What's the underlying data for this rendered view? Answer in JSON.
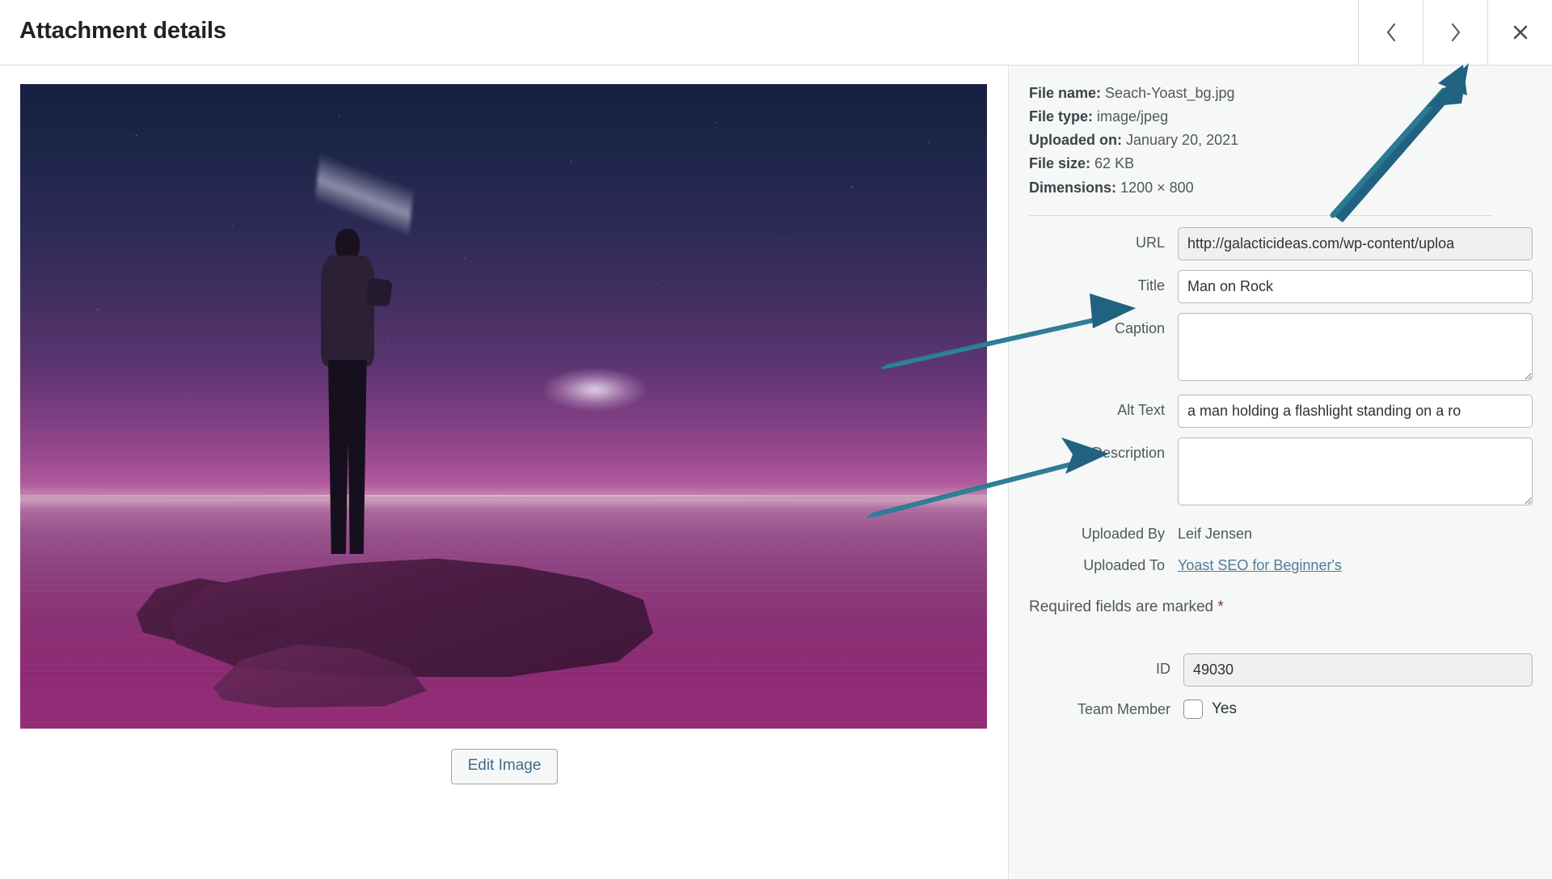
{
  "header": {
    "title": "Attachment details",
    "prev_icon": "chevron-left-icon",
    "next_icon": "chevron-right-icon",
    "close_icon": "close-icon"
  },
  "media": {
    "edit_image_label": "Edit Image",
    "image_alt": "a man holding a flashlight standing on a rock"
  },
  "meta": {
    "file_name_label": "File name:",
    "file_name_value": "Seach-Yoast_bg.jpg",
    "file_type_label": "File type:",
    "file_type_value": "image/jpeg",
    "uploaded_on_label": "Uploaded on:",
    "uploaded_on_value": "January 20, 2021",
    "file_size_label": "File size:",
    "file_size_value": "62 KB",
    "dimensions_label": "Dimensions:",
    "dimensions_value": "1200 × 800"
  },
  "fields": {
    "url_label": "URL",
    "url_value": "http://galacticideas.com/wp-content/uploa",
    "title_label": "Title",
    "title_value": "Man on Rock",
    "caption_label": "Caption",
    "caption_value": "",
    "alt_text_label": "Alt Text",
    "alt_text_value": "a man holding a flashlight standing on a ro",
    "description_label": "Description",
    "description_value": "",
    "uploaded_by_label": "Uploaded By",
    "uploaded_by_value": "Leif Jensen",
    "uploaded_to_label": "Uploaded To",
    "uploaded_to_value": "Yoast SEO for Beginner's"
  },
  "required_note": {
    "text": "Required fields are marked ",
    "marker": "*"
  },
  "bottom": {
    "id_label": "ID",
    "id_value": "49030",
    "team_member_label": "Team Member",
    "team_member_option": "Yes"
  },
  "colors": {
    "annotation_arrow": "#226080",
    "link": "#4f7d95",
    "required_marker": "#8a2d4f",
    "panel_bg": "#f6f7f7"
  }
}
